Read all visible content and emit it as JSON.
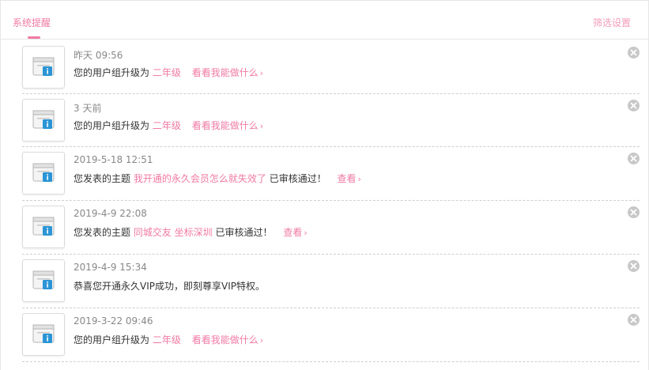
{
  "header": {
    "tab_label": "系统提醒",
    "filter_label": "筛选设置"
  },
  "notifications": [
    {
      "time": "昨天 09:56",
      "text": "您的用户组升级为",
      "highlight": "二年级",
      "suffix": "",
      "link": "看看我能做什么",
      "chevron": "›"
    },
    {
      "time": "3 天前",
      "text": "您的用户组升级为",
      "highlight": "二年级",
      "suffix": "",
      "link": "看看我能做什么",
      "chevron": "›"
    },
    {
      "time": "2019-5-18 12:51",
      "text": "您发表的主题",
      "highlight": "我开通的永久会员怎么就失效了",
      "suffix": "已审核通过！",
      "link": "查看",
      "chevron": "›"
    },
    {
      "time": "2019-4-9 22:08",
      "text": "您发表的主题",
      "highlight": "同城交友 坐标深圳",
      "suffix": "已审核通过！",
      "link": "查看",
      "chevron": "›"
    },
    {
      "time": "2019-4-9 15:34",
      "text": "恭喜您开通永久VIP成功，即刻尊享VIP特权。",
      "highlight": "",
      "suffix": "",
      "link": "",
      "chevron": ""
    },
    {
      "time": "2019-3-22 09:46",
      "text": "您的用户组升级为",
      "highlight": "二年级",
      "suffix": "",
      "link": "看看我能做什么",
      "chevron": "›"
    }
  ],
  "colors": {
    "accent": "#f07aa4",
    "filter": "#f39ab9",
    "close_bg": "#c8c8c8",
    "icon_blue": "#2b95d6"
  },
  "icons": {
    "notification": "info-window-icon",
    "dismiss": "close-icon"
  }
}
